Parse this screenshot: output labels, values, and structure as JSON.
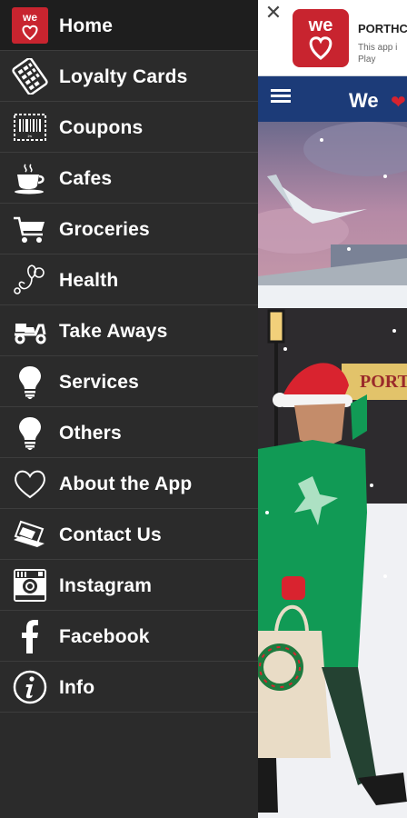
{
  "drawer": {
    "items": [
      {
        "label": "Home",
        "icon": "home-heart-icon",
        "active": true
      },
      {
        "label": "Loyalty Cards",
        "icon": "loyalty-card-icon"
      },
      {
        "label": "Coupons",
        "icon": "coupon-icon"
      },
      {
        "label": "Cafes",
        "icon": "coffee-cup-icon"
      },
      {
        "label": "Groceries",
        "icon": "shopping-cart-icon"
      },
      {
        "label": "Health",
        "icon": "stethoscope-icon"
      },
      {
        "label": "Take Aways",
        "icon": "scooter-icon"
      },
      {
        "label": "Services",
        "icon": "lightbulb-icon"
      },
      {
        "label": "Others",
        "icon": "lightbulb-icon"
      },
      {
        "label": "About the App",
        "icon": "heart-outline-icon"
      },
      {
        "label": "Contact Us",
        "icon": "laptop-icon"
      },
      {
        "label": "Instagram",
        "icon": "instagram-icon"
      },
      {
        "label": "Facebook",
        "icon": "facebook-icon"
      },
      {
        "label": "Info",
        "icon": "info-icon"
      }
    ]
  },
  "banner": {
    "logo_text": "we",
    "title": "PORTHC",
    "subtitle": "This app i Play"
  },
  "topbar": {
    "title": "We"
  },
  "colors": {
    "brand_red": "#c8242f",
    "topbar_blue": "#1c3b78",
    "drawer_bg": "#2b2b2b"
  }
}
